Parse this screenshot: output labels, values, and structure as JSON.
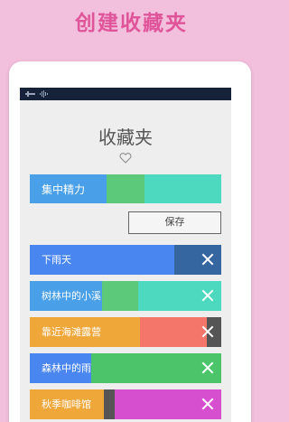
{
  "promo": {
    "title": "创建收藏夹"
  },
  "screen": {
    "title": "收藏夹",
    "name_field": {
      "value": "集中精力"
    },
    "save_label": "保存"
  },
  "favorites": [
    {
      "label": "下雨天",
      "colors": [
        "#4a86f0",
        "#3566a0"
      ]
    },
    {
      "label": "树林中的小溪",
      "colors": [
        "#4aa0e8",
        "#5cc97a",
        "#4cd9c0"
      ]
    },
    {
      "label": "靠近海滩露营",
      "colors": [
        "#f0a73a",
        "#f4756a",
        "#555555"
      ]
    },
    {
      "label": "森林中的雨",
      "colors": [
        "#4a86f0",
        "#4cc56a"
      ]
    },
    {
      "label": "秋季咖啡馆",
      "colors": [
        "#f0a73a",
        "#555555",
        "#d54fcf"
      ]
    }
  ],
  "icons": {
    "heart": "heart-outline-icon",
    "close": "close-icon",
    "status_1": "signal-icon",
    "status_2": "wave-icon"
  }
}
